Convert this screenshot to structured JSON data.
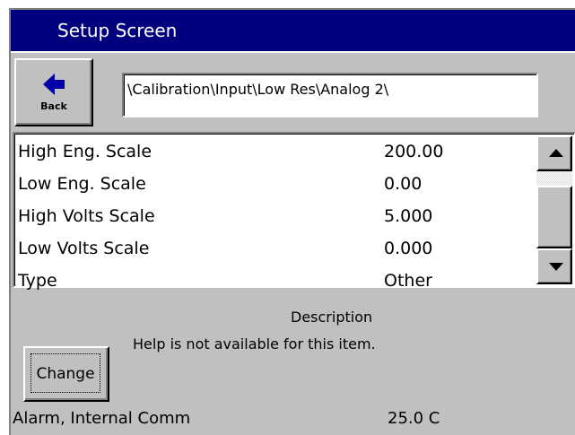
{
  "window": {
    "title": "Setup Screen"
  },
  "toolbar": {
    "back_label": "Back",
    "back_icon": "left-arrow-icon",
    "path": "\\Calibration\\Input\\Low Res\\Analog 2\\"
  },
  "list": {
    "rows": [
      {
        "name": "High Eng. Scale",
        "value": "200.00"
      },
      {
        "name": "Low Eng. Scale",
        "value": "0.00"
      },
      {
        "name": "High Volts Scale",
        "value": "5.000"
      },
      {
        "name": "Low Volts Scale",
        "value": "0.000"
      },
      {
        "name": "Type",
        "value": "Other"
      }
    ]
  },
  "scrollbar": {
    "up_icon": "scroll-up-arrow-icon",
    "down_icon": "scroll-down-arrow-icon"
  },
  "description": {
    "label": "Description",
    "text": "Help is not available for this item."
  },
  "actions": {
    "change_label": "Change"
  },
  "status": {
    "message": "Alarm, Internal Comm",
    "temperature": "25.0 C"
  },
  "colors": {
    "titlebar": "#00007f",
    "panel": "#c0c0c0",
    "back_arrow": "#0000a8"
  }
}
